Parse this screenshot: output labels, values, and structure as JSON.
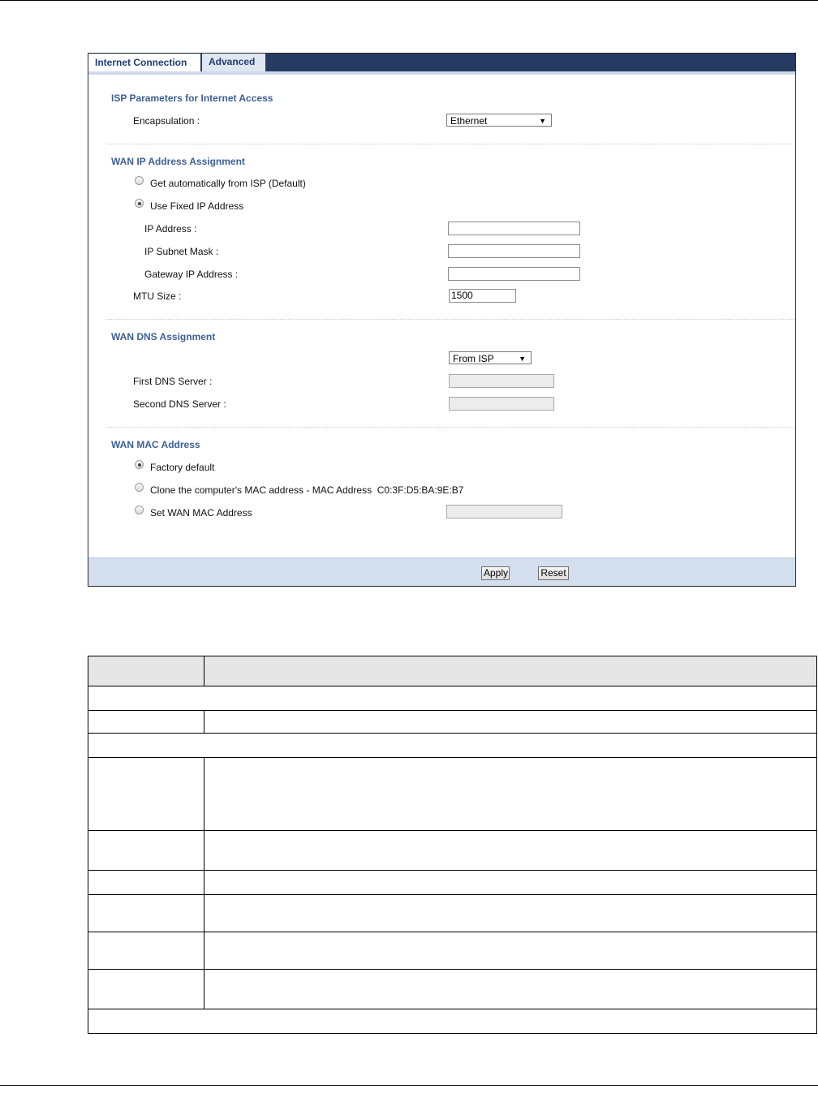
{
  "tabs": [
    {
      "label": "Internet Connection",
      "active": true
    },
    {
      "label": "Advanced",
      "active": false
    }
  ],
  "isp": {
    "title": "ISP Parameters for Internet Access",
    "encapsulation_label": "Encapsulation :",
    "encapsulation_value": "Ethernet"
  },
  "wan_ip": {
    "title": "WAN IP Address Assignment",
    "option_auto": "Get automatically from ISP (Default)",
    "option_fixed": "Use Fixed IP Address",
    "selected": "fixed",
    "ip_label": "IP Address :",
    "ip_value": "",
    "subnet_label": "IP Subnet Mask :",
    "subnet_value": "",
    "gateway_label": "Gateway IP Address :",
    "gateway_value": "",
    "mtu_label": "MTU Size :",
    "mtu_value": "1500"
  },
  "wan_dns": {
    "title": "WAN DNS Assignment",
    "mode_value": "From ISP",
    "first_label": "First DNS Server :",
    "first_value": "",
    "second_label": "Second DNS Server :",
    "second_value": ""
  },
  "wan_mac": {
    "title": "WAN MAC Address",
    "option_factory": "Factory default",
    "option_clone": "Clone the computer's MAC address - MAC Address  C0:3F:D5:BA:9E:B7",
    "option_set": "Set WAN MAC Address",
    "selected": "factory",
    "set_value": ""
  },
  "buttons": {
    "apply": "Apply",
    "reset": "Reset"
  },
  "colors": {
    "tab_bar": "#263b62",
    "section_title": "#3d5f93",
    "footer": "#d3dfef"
  },
  "icons": {
    "dropdown": "down-triangle"
  }
}
